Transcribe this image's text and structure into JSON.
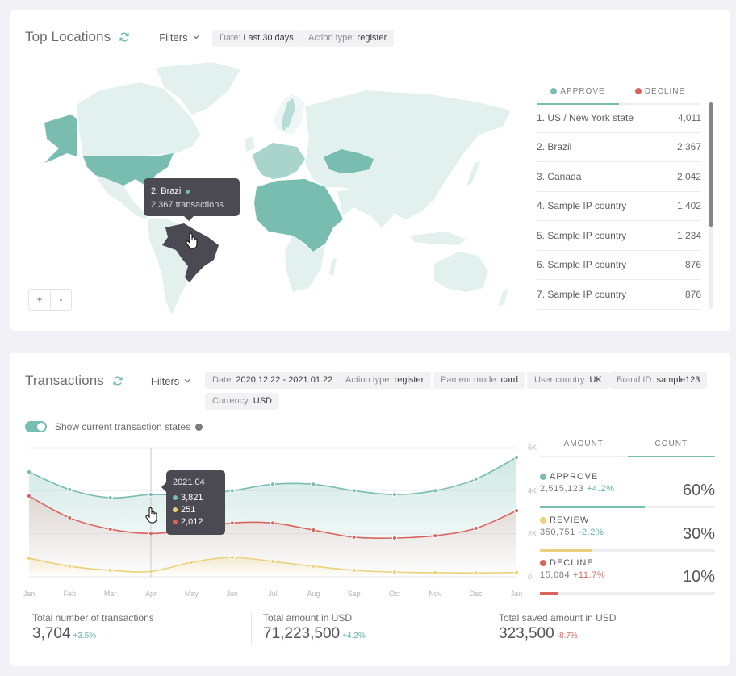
{
  "colors": {
    "approve": "#79bdb1",
    "review": "#ead27a",
    "decline": "#d9645d",
    "map_high": "#79bdb1",
    "map_mid": "#a8d4cb",
    "map_low": "#e3f1ee",
    "map_selected": "#4b4a52"
  },
  "top_locations": {
    "title": "Top Locations",
    "filters_label": "Filters",
    "chips": [
      {
        "key": "Date:",
        "value": "Last 30 days"
      },
      {
        "key": "Action type:",
        "value": "register"
      }
    ],
    "zoom_in": "+",
    "zoom_out": "-",
    "tooltip": {
      "title": "2. Brazil",
      "subtitle": "2,367 transactions"
    },
    "tabs": [
      {
        "label": "APPROVE",
        "active": true
      },
      {
        "label": "DECLINE",
        "active": false
      }
    ],
    "list": [
      {
        "label": "1. US / New York state",
        "value": "4,011"
      },
      {
        "label": "2. Brazil",
        "value": "2,367"
      },
      {
        "label": "3. Canada",
        "value": "2,042"
      },
      {
        "label": "4. Sample IP country",
        "value": "1,402"
      },
      {
        "label": "5. Sample IP country",
        "value": "1,234"
      },
      {
        "label": "6. Sample IP country",
        "value": "876"
      },
      {
        "label": "7. Sample IP country",
        "value": "876"
      }
    ],
    "highlighted_regions": [
      "US",
      "Alaska",
      "Sweden",
      "Kazakhstan",
      "North Africa",
      "Central/East Africa",
      "Brazil"
    ]
  },
  "transactions": {
    "title": "Transactions",
    "filters_label": "Filters",
    "chips": [
      {
        "key": "Date:",
        "value": "2020.12.22 - 2021.01.22"
      },
      {
        "key": "Action type:",
        "value": "register"
      },
      {
        "key": "Pament mode:",
        "value": "card"
      },
      {
        "key": "User country:",
        "value": "UK"
      },
      {
        "key": "Brand ID:",
        "value": "sample123"
      },
      {
        "key": "Currency:",
        "value": "USD"
      }
    ],
    "toggle_label": "Show current transaction states",
    "toggle_on": true,
    "info_glyph": "i",
    "tooltip": {
      "title": "2021.04",
      "values": [
        "3,821",
        "251",
        "2,012"
      ]
    },
    "tabs": [
      {
        "label": "AMOUNT",
        "active": false
      },
      {
        "label": "COUNT",
        "active": true
      }
    ],
    "states": [
      {
        "name": "APPROVE",
        "value": "2,515,123",
        "delta": "+4.2%",
        "trend": "up",
        "percent_label": "60%",
        "percent": 60
      },
      {
        "name": "REVIEW",
        "value": "350,751",
        "delta": "-2.2%",
        "trend": "up",
        "percent_label": "30%",
        "percent": 30
      },
      {
        "name": "DECLINE",
        "value": "15,084",
        "delta": "+11.7%",
        "trend": "down",
        "percent_label": "10%",
        "percent": 10
      }
    ],
    "totals": [
      {
        "label": "Total number of transactions",
        "value": "3,704",
        "delta": "+3.5%",
        "trend": "up"
      },
      {
        "label": "Total amount in USD",
        "value": "71,223,500",
        "delta": "+4.2%",
        "trend": "up"
      },
      {
        "label": "Total saved amount in USD",
        "value": "323,500",
        "delta": "-8.7%",
        "trend": "down"
      }
    ]
  },
  "chart_data": {
    "type": "area",
    "title": "",
    "xlabel": "",
    "ylabel": "",
    "categories": [
      "Jan",
      "Feb",
      "Mar",
      "Apr",
      "May",
      "Jun",
      "Jul",
      "Aug",
      "Sep",
      "Oct",
      "Nov",
      "Dec",
      "Jan"
    ],
    "y_ticks": [
      "0",
      "2K",
      "4K",
      "6K"
    ],
    "ylim": [
      0,
      6000
    ],
    "grid": true,
    "y_axis_side": "right",
    "highlight_index": 3,
    "series": [
      {
        "name": "Approve",
        "color": "#79bdb1",
        "values": [
          4870,
          4050,
          3670,
          3821,
          3800,
          4000,
          4300,
          4300,
          4000,
          3820,
          4000,
          4540,
          5550
        ]
      },
      {
        "name": "Decline",
        "color": "#d9645d",
        "values": [
          3750,
          2740,
          2210,
          2012,
          2200,
          2500,
          2500,
          2170,
          1840,
          1800,
          1910,
          2250,
          3070
        ]
      },
      {
        "name": "Review",
        "color": "#ead27a",
        "values": [
          860,
          490,
          300,
          251,
          670,
          900,
          710,
          490,
          300,
          220,
          190,
          180,
          200
        ]
      }
    ]
  }
}
